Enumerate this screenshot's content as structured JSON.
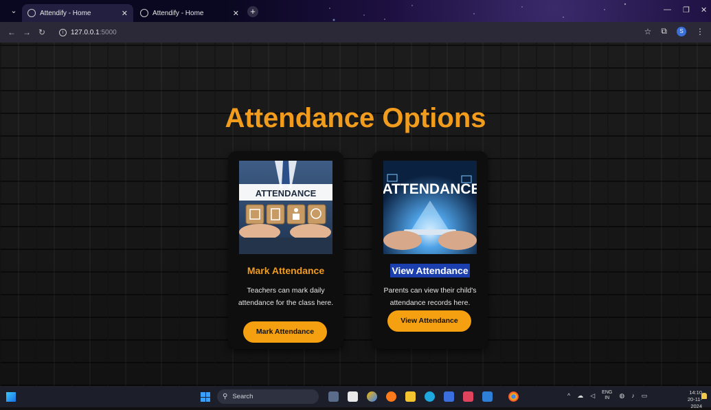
{
  "browser": {
    "tabs": [
      {
        "label": "Attendify - Home",
        "active": true
      },
      {
        "label": "Attendify - Home",
        "active": false
      }
    ],
    "url_host": "127.0.0.1",
    "url_port": ":5000",
    "profile_initial": "S"
  },
  "page": {
    "title": "Attendance Options",
    "cards": [
      {
        "image_text": "ATTENDANCE",
        "title": "Mark Attendance",
        "description": "Teachers can mark daily attendance for the class here.",
        "button": "Mark Attendance"
      },
      {
        "image_text": "ATTENDANCE",
        "title": "View Attendance",
        "description": "Parents can view their child's attendance records here.",
        "button": "View Attendance"
      }
    ]
  },
  "taskbar": {
    "search_placeholder": "Search",
    "lang_top": "ENG",
    "lang_bottom": "IN",
    "time": "14:10",
    "date": "20-11-2024"
  },
  "colors": {
    "accent_orange": "#f29c1d",
    "button_orange": "#f5a010",
    "selection_blue": "#1b3fae"
  }
}
